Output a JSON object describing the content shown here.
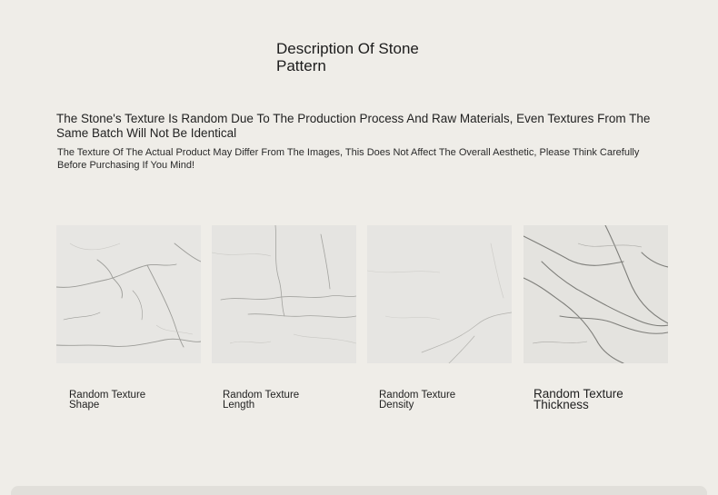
{
  "section": {
    "title": "Description Of Stone Pattern",
    "lead": "The Stone's Texture Is Random Due To The Production Process And Raw Materials, Even Textures From The Same Batch Will Not Be Identical",
    "note": "The Texture Of The Actual Product May Differ From The Images, This Does Not Affect The Overall Aesthetic, Please Think Carefully Before Purchasing If You Mind!"
  },
  "cards": [
    {
      "caption_line1": "Random Texture",
      "caption_line2": "Shape"
    },
    {
      "caption_line1": "Random Texture",
      "caption_line2": "Length"
    },
    {
      "caption_line1": "Random Texture",
      "caption_line2": "Density"
    },
    {
      "caption_line1": "Random Texture",
      "caption_line2": "Thickness"
    }
  ]
}
